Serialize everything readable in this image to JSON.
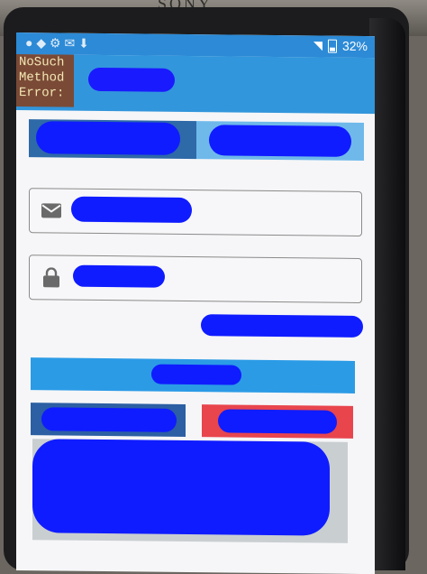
{
  "device": {
    "brand": "SONY"
  },
  "status_bar": {
    "battery": "32%",
    "wifi_icon": "wifi-icon",
    "battery_icon": "battery-icon"
  },
  "error": {
    "text": "NoSuch\nMethod\nError:"
  },
  "form": {
    "email_icon": "mail-icon",
    "password_icon": "lock-icon"
  },
  "colors": {
    "appbar": "#3296dc",
    "status_bar": "#2c8ad6",
    "tab_active": "#2e69a8",
    "tab_inactive": "#6fb9ea",
    "primary_button": "#2b9be6",
    "secondary_button": "#2c5fa3",
    "danger_button": "#e8454d",
    "redaction": "#0f1cff"
  }
}
